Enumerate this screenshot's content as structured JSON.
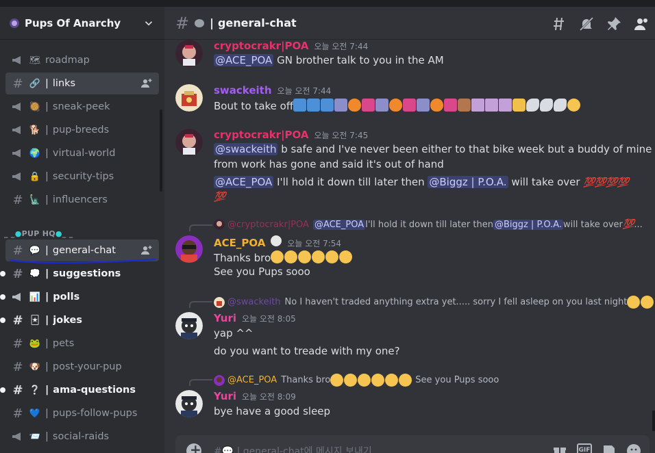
{
  "server": {
    "name": "Pups Of Anarchy"
  },
  "channels_top": [
    {
      "name": "roadmap",
      "prefix": "",
      "icon": "megaphone-icon",
      "emoji": "🗺"
    },
    {
      "name": "links",
      "prefix": "| ",
      "icon": "hash-icon",
      "emoji": "🔗",
      "selected_hover": true
    },
    {
      "name": "sneak-peek",
      "prefix": "| ",
      "icon": "megaphone-icon",
      "emoji": "🥘"
    },
    {
      "name": "pup-breeds",
      "prefix": "| ",
      "icon": "megaphone-icon",
      "emoji": "🐕"
    },
    {
      "name": "virtual-world",
      "prefix": "| ",
      "icon": "megaphone-icon",
      "emoji": "🌍"
    },
    {
      "name": "security-tips",
      "prefix": "| ",
      "icon": "megaphone-icon",
      "emoji": "🔒"
    },
    {
      "name": "influencers",
      "prefix": "| ",
      "icon": "hash-icon",
      "emoji": "🗽"
    }
  ],
  "category": {
    "label_left": "_ _",
    "label_mid": "PUP HQ",
    "label_right": "_ _"
  },
  "channels_hq": [
    {
      "name": "general-chat",
      "prefix": "| ",
      "icon": "hash-icon",
      "emoji": "💬",
      "state": "selected"
    },
    {
      "name": "suggestions",
      "prefix": "| ",
      "icon": "hash-icon",
      "emoji": "💭",
      "state": "unread"
    },
    {
      "name": "polls",
      "prefix": "| ",
      "icon": "megaphone-icon",
      "emoji": "📊",
      "state": "unread"
    },
    {
      "name": "jokes",
      "prefix": "| ",
      "icon": "hash-icon",
      "emoji": "🃏",
      "state": "unread"
    },
    {
      "name": "pets",
      "prefix": "| ",
      "icon": "hash-icon",
      "emoji": "🐸",
      "state": ""
    },
    {
      "name": "post-your-pup",
      "prefix": "| ",
      "icon": "hash-icon",
      "emoji": "🐶",
      "state": ""
    },
    {
      "name": "ama-questions",
      "prefix": "| ",
      "icon": "hash-icon",
      "emoji": "❔",
      "state": "unread"
    },
    {
      "name": "pups-follow-pups",
      "prefix": "| ",
      "icon": "hash-icon",
      "emoji": "💙",
      "state": ""
    },
    {
      "name": "social-raids",
      "prefix": "| ",
      "icon": "megaphone-icon",
      "emoji": "📨",
      "state": ""
    }
  ],
  "header": {
    "hash": "#",
    "separator": "|",
    "title": "general-chat"
  },
  "messages": [
    {
      "author": "cryptocrakr|POA",
      "author_color": "#e9306b",
      "time": "오늘 오전 7:44",
      "lines": [
        {
          "mention": "@ACE_POA",
          "text": " GN brother talk to you in the AM"
        }
      ]
    },
    {
      "author": "swackeith",
      "author_color": "#a55cf5",
      "time": "오늘 오전 7:44",
      "text": "Bout to take off"
    },
    {
      "author": "cryptocrakr|POA",
      "author_color": "#e9306b",
      "time": "오늘 오전 7:45",
      "line1_mention": "@swackeith",
      "line1_text": " b safe and I've never been either to that bike week but a buddy of mine",
      "line2_text": "from work has gone and said it's out of hand",
      "line3_mention": "@ACE_POA",
      "line3_text": " I'll hold it down till later then ",
      "line3_mention2": "@Biggz | P.O.A.",
      "line3_text2": " will take over"
    },
    {
      "reply_author": "@cryptocrakr|POA",
      "reply_mention": "@ACE_POA",
      "reply_text": " I'll hold it down till later then ",
      "reply_mention2": "@Biggz | P.O.A.",
      "reply_text2": " will take over ",
      "author": "ACE_POA",
      "author_color": "#f0b232",
      "time": "오늘 오전 7:54",
      "line1_text": "Thanks bro",
      "line2_text": "See you Pups sooo"
    },
    {
      "reply_author": "@swackeith",
      "reply_text": "No I haven't traded anything extra yet..... sorry I fell asleep on you last night",
      "author": "Yuri",
      "author_color": "#eb459e",
      "time": "오늘 오전 8:05",
      "line1_text": "yap ^^",
      "line2_text": "do you want to treade with my one?"
    },
    {
      "reply_author": "@ACE_POA",
      "reply_text": "Thanks bro",
      "reply_text2": "See you Pups sooo",
      "author": "Yuri",
      "author_color": "#eb459e",
      "time": "오늘 오전 8:09",
      "line1_text": "bye have a good sleep"
    }
  ],
  "composer": {
    "placeholder": "#💬 | general-chat에 메시지 보내기"
  },
  "colors": {
    "accent": "#5865f2",
    "unread_dot": "#f2f3f5",
    "mention_bg": "#3c4270"
  }
}
